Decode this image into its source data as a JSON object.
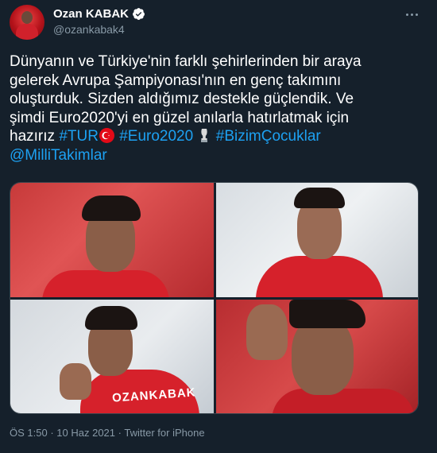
{
  "user": {
    "display_name": "Ozan KABAK",
    "handle": "@ozankabak4",
    "verified": true
  },
  "tweet": {
    "text_lines": [
      "Dünyanın ve Türkiye'nin farklı şehirlerinden bir araya",
      "gelerek Avrupa Şampiyonası'nın en genç takımını",
      "oluşturduk. Sizden aldığımız destekle güçlendik. Ve",
      "şimdi Euro2020'yi en güzel anılarla hatırlatmak için"
    ],
    "last_line_prefix": "hazırız",
    "hashtag_1": "#TUR",
    "hashtag_2": "#Euro2020",
    "hashtag_3": "#BizimÇocuklar",
    "mention": "@MilliTakimlar",
    "emoji": [
      "turkey-flag",
      "trophy"
    ]
  },
  "photos": {
    "photo_4_shirt_text": "OZANKABAK"
  },
  "meta": {
    "time": "ÖS 1:50",
    "date": "10 Haz 2021",
    "source": "Twitter for iPhone",
    "separator": "·"
  },
  "colors": {
    "background": "#15202b",
    "link": "#1da1f2",
    "secondary_text": "#8899a6",
    "verified_badge": "#ffffff"
  }
}
